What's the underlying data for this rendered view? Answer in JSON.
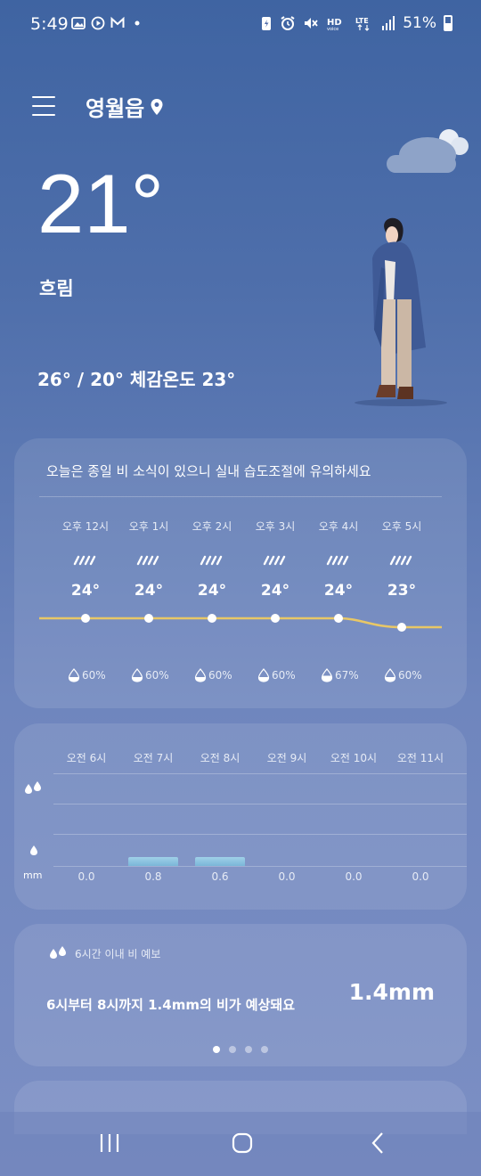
{
  "status_bar": {
    "time": "5:49",
    "battery": "51%",
    "icons": [
      "image-icon",
      "play-icon",
      "gmail-icon",
      "dot-icon",
      "battery-saver-icon",
      "alarm-icon",
      "mute-icon",
      "hd-voice-icon",
      "lte-icon",
      "signal-icon"
    ]
  },
  "header": {
    "location": "영월읍"
  },
  "current": {
    "temperature": "21°",
    "condition": "흐림",
    "hi_lo": "26° / 20°",
    "feels_like": "체감온도 23°"
  },
  "hourly_card": {
    "notice": "오늘은 종일 비 소식이 있으니 실내 습도조절에 유의하세요",
    "hours": [
      {
        "time": "오후 12시",
        "temp": "24°",
        "humidity": "60%"
      },
      {
        "time": "오후 1시",
        "temp": "24°",
        "humidity": "60%"
      },
      {
        "time": "오후 2시",
        "temp": "24°",
        "humidity": "60%"
      },
      {
        "time": "오후 3시",
        "temp": "24°",
        "humidity": "60%"
      },
      {
        "time": "오후 4시",
        "temp": "24°",
        "humidity": "67%"
      },
      {
        "time": "오후 5시",
        "temp": "23°",
        "humidity": "60%"
      }
    ],
    "line_color": "#e8c766"
  },
  "precip_card": {
    "unit": "mm",
    "hours": [
      {
        "time": "오전 6시",
        "value": "0.0"
      },
      {
        "time": "오전 7시",
        "value": "0.8"
      },
      {
        "time": "오전 8시",
        "value": "0.6"
      },
      {
        "time": "오전 9시",
        "value": "0.0"
      },
      {
        "time": "오전 10시",
        "value": "0.0"
      },
      {
        "time": "오전 11시",
        "value": "0.0"
      }
    ]
  },
  "rain_card": {
    "title": "6시간 이내 비 예보",
    "description": "6시부터 8시까지 1.4mm의 비가 예상돼요",
    "total": "1.4mm",
    "pages": 4,
    "active_page": 1
  }
}
